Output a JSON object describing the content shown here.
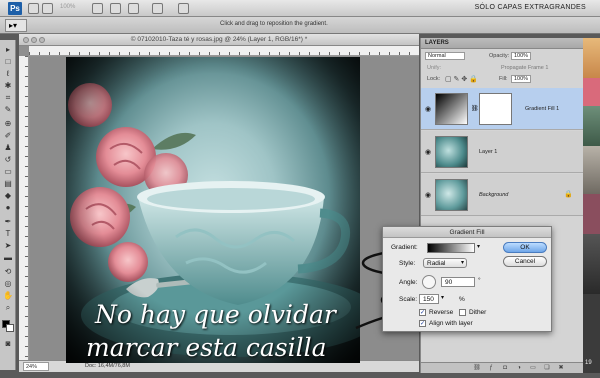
{
  "menubar": {
    "app_icon": "Ps",
    "zoom": "100%",
    "workspace": "SÓLO CAPAS EXTRAGRANDES"
  },
  "optionsbar": {
    "hint": "Click and drag to reposition the gradient."
  },
  "document": {
    "title": "© 07102010-Taza té y rosas.jpg @ 24% (Layer 1, RGB/16*) *",
    "status_zoom": "24%",
    "status_doc": "Doc: 16,4M/76,8M"
  },
  "layers_panel": {
    "tab": "LAYERS",
    "blend_mode": "Normal",
    "opacity_label": "Opacity:",
    "opacity_value": "100%",
    "lock_label": "Lock:",
    "propagate_label": "Propagate Frame 1",
    "fill_label": "Fill:",
    "fill_value": "100%",
    "layers": [
      {
        "name": "Gradient Fill 1",
        "selected": true
      },
      {
        "name": "Layer 1",
        "selected": false
      },
      {
        "name": "Background",
        "selected": false
      }
    ]
  },
  "gradient_dialog": {
    "title": "Gradient Fill",
    "gradient_label": "Gradient:",
    "style_label": "Style:",
    "style_value": "Radial",
    "angle_label": "Angle:",
    "angle_value": "90",
    "angle_unit": "°",
    "scale_label": "Scale:",
    "scale_value": "150",
    "scale_unit": "%",
    "reverse_label": "Reverse",
    "reverse_checked": true,
    "dither_label": "Dither",
    "dither_checked": false,
    "align_label": "Align with layer",
    "align_checked": true,
    "ok_label": "OK",
    "cancel_label": "Cancel"
  },
  "annotation": {
    "line1": "No hay que olvidar",
    "line2": "marcar esta casilla"
  },
  "right_strip": {
    "bottom_number": "19"
  },
  "colors": {
    "selection_blue": "#b7cfee",
    "ok_button": "#6fa6e8",
    "annotation_ellipse": "#111111"
  }
}
